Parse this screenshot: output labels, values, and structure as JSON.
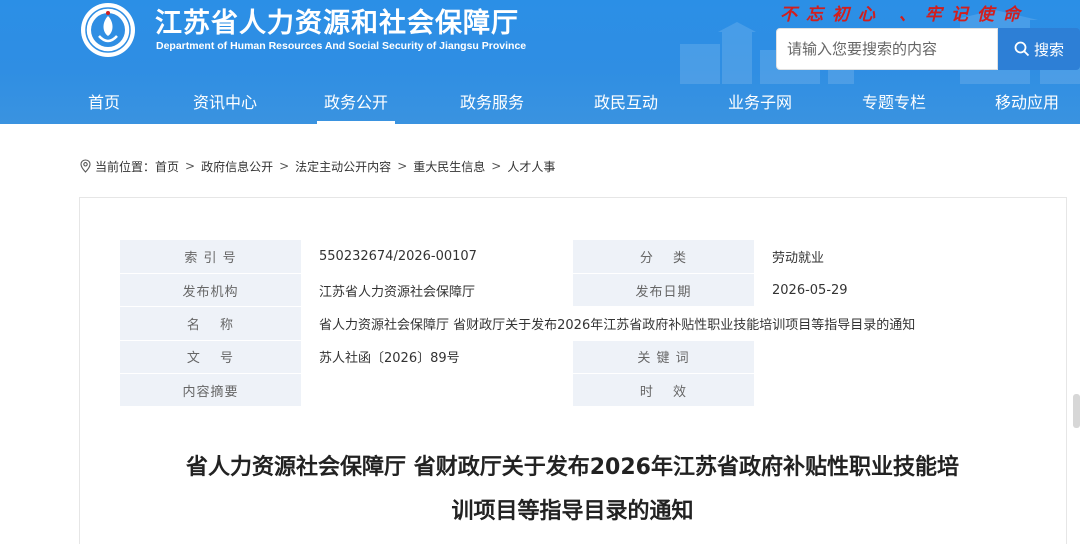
{
  "header": {
    "site_title": "江苏省人力资源和社会保障厅",
    "site_subtitle": "Department of Human Resources And Social Security of Jiangsu Province",
    "slogan": "不忘初心 、牢记使命",
    "search_placeholder": "请输入您要搜索的内容",
    "search_button": "搜索"
  },
  "nav": {
    "items": [
      {
        "label": "首页"
      },
      {
        "label": "资讯中心"
      },
      {
        "label": "政务公开"
      },
      {
        "label": "政务服务"
      },
      {
        "label": "政民互动"
      },
      {
        "label": "业务子网"
      },
      {
        "label": "专题专栏"
      },
      {
        "label": "移动应用"
      }
    ],
    "active_index": 2
  },
  "breadcrumb": {
    "prefix": "当前位置：",
    "items": [
      "首页",
      "政府信息公开",
      "法定主动公开内容",
      "重大民生信息",
      "人才人事"
    ],
    "separator": ">"
  },
  "meta": {
    "index_label": "索 引 号",
    "index_value": "550232674/2026-00107",
    "category_label": "分　 类",
    "category_value": "劳动就业",
    "publisher_label": "发布机构",
    "publisher_value": "江苏省人力资源社会保障厅",
    "date_label": "发布日期",
    "date_value": "2026-05-29",
    "name_label": "名　 称",
    "name_value": "省人力资源社会保障厅 省财政厅关于发布2026年江苏省政府补贴性职业技能培训项目等指导目录的通知",
    "docno_label": "文　 号",
    "docno_value": "苏人社函〔2026〕89号",
    "keywords_label": "关 键 词",
    "keywords_value": "",
    "summary_label": "内容摘要",
    "summary_value": "",
    "validity_label": "时　 效",
    "validity_value": ""
  },
  "article": {
    "title_line1": "省人力资源社会保障厅 省财政厅关于发布2026年江苏省政府补贴性职业技能培",
    "title_line2": "训项目等指导目录的通知"
  },
  "colors": {
    "header_blue": "#2f8ee3",
    "slogan_red": "#d11e1e",
    "search_btn": "#2d7fd6",
    "label_bg": "#eef2f8"
  }
}
